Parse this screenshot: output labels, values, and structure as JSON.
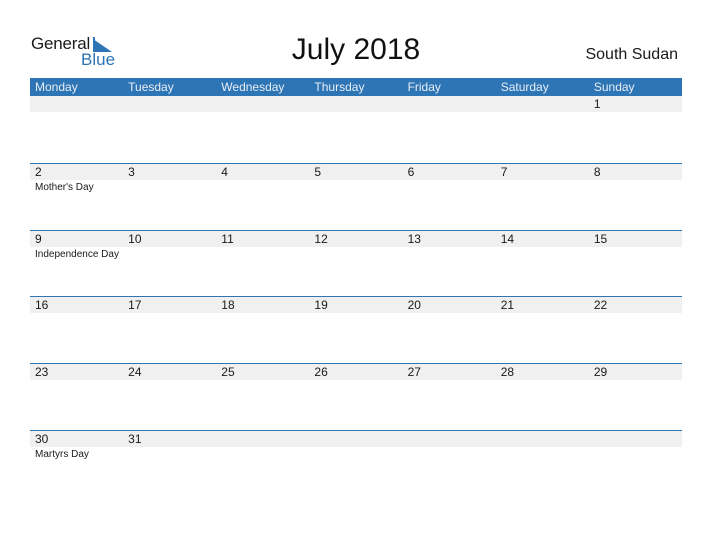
{
  "logo": {
    "general": "General",
    "blue": "Blue"
  },
  "title": "July 2018",
  "country": "South Sudan",
  "weekdays": [
    "Monday",
    "Tuesday",
    "Wednesday",
    "Thursday",
    "Friday",
    "Saturday",
    "Sunday"
  ],
  "weeks": [
    {
      "days": [
        "",
        "",
        "",
        "",
        "",
        "",
        "1"
      ],
      "events": [
        "",
        "",
        "",
        "",
        "",
        "",
        ""
      ]
    },
    {
      "days": [
        "2",
        "3",
        "4",
        "5",
        "6",
        "7",
        "8"
      ],
      "events": [
        "Mother's Day",
        "",
        "",
        "",
        "",
        "",
        ""
      ]
    },
    {
      "days": [
        "9",
        "10",
        "11",
        "12",
        "13",
        "14",
        "15"
      ],
      "events": [
        "Independence Day",
        "",
        "",
        "",
        "",
        "",
        ""
      ]
    },
    {
      "days": [
        "16",
        "17",
        "18",
        "19",
        "20",
        "21",
        "22"
      ],
      "events": [
        "",
        "",
        "",
        "",
        "",
        "",
        ""
      ]
    },
    {
      "days": [
        "23",
        "24",
        "25",
        "26",
        "27",
        "28",
        "29"
      ],
      "events": [
        "",
        "",
        "",
        "",
        "",
        "",
        ""
      ]
    },
    {
      "days": [
        "30",
        "31",
        "",
        "",
        "",
        "",
        ""
      ],
      "events": [
        "Martyrs Day",
        "",
        "",
        "",
        "",
        "",
        ""
      ]
    }
  ],
  "colors": {
    "accent": "#2e75b6",
    "band": "#f0f0f0"
  }
}
